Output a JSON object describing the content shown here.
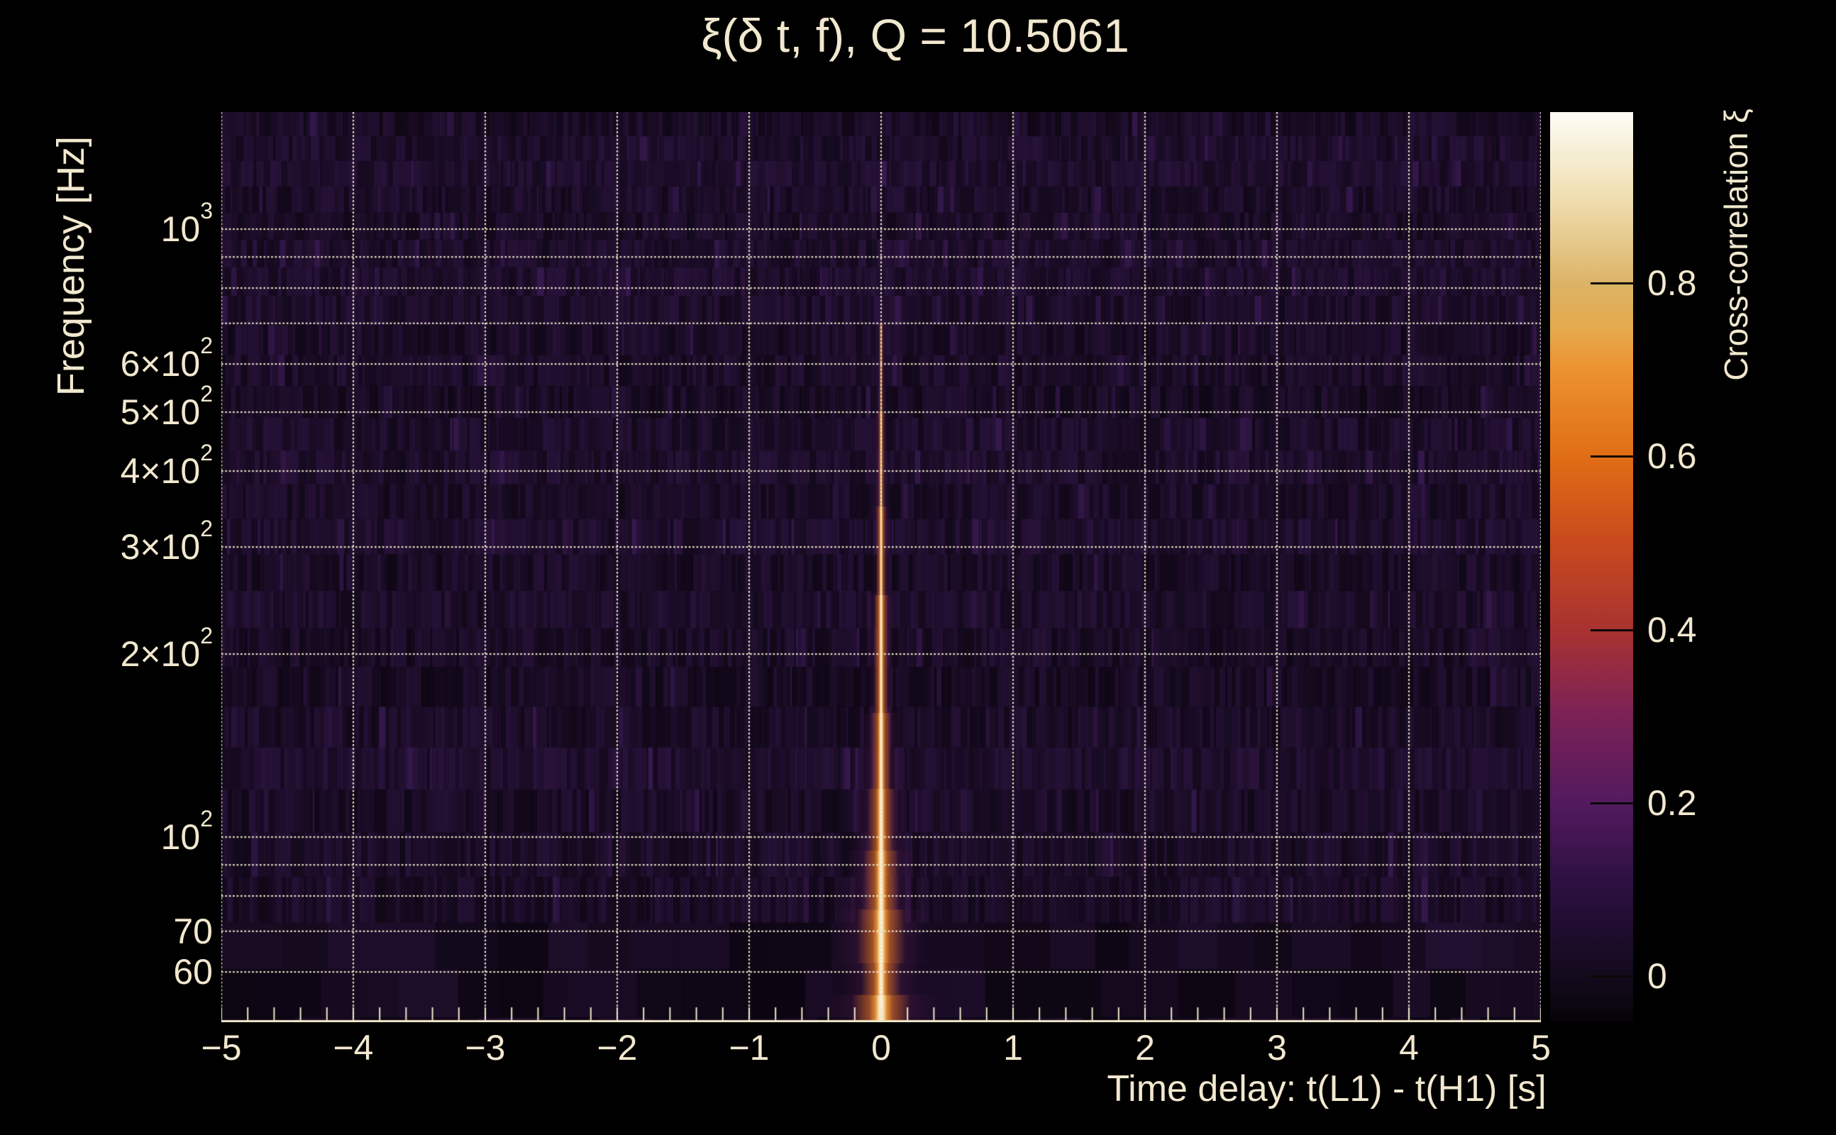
{
  "window": {
    "background": "#000000"
  },
  "title": "ξ(δ t, f), Q = 10.5061",
  "colors": {
    "text": "#f2e8cf",
    "grid": "#efe6ca",
    "axis_line": "#efe6ca",
    "heatmap_base": "#190e23",
    "colorbar_tick": "#0b0805"
  },
  "axes": {
    "x": {
      "label": "Time delay: t(L1) - t(H1) [s]",
      "range": [
        -5,
        5
      ],
      "minor_step": 0.2,
      "major_ticks": [
        {
          "v": -5,
          "label": "−5"
        },
        {
          "v": -4,
          "label": "−4"
        },
        {
          "v": -3,
          "label": "−3"
        },
        {
          "v": -2,
          "label": "−2"
        },
        {
          "v": -1,
          "label": "−1"
        },
        {
          "v": 0,
          "label": "0"
        },
        {
          "v": 1,
          "label": "1"
        },
        {
          "v": 2,
          "label": "2"
        },
        {
          "v": 3,
          "label": "3"
        },
        {
          "v": 4,
          "label": "4"
        },
        {
          "v": 5,
          "label": "5"
        }
      ]
    },
    "y": {
      "label": "Frequency [Hz]",
      "scale": "log",
      "range_hz": [
        50,
        1558
      ],
      "labeled_ticks": [
        {
          "f": 1000,
          "mant": "10",
          "exp": "3"
        },
        {
          "f": 600,
          "mant": "6×10",
          "exp": "2"
        },
        {
          "f": 500,
          "mant": "5×10",
          "exp": "2"
        },
        {
          "f": 400,
          "mant": "4×10",
          "exp": "2"
        },
        {
          "f": 300,
          "mant": "3×10",
          "exp": "2"
        },
        {
          "f": 200,
          "mant": "2×10",
          "exp": "2"
        },
        {
          "f": 100,
          "mant": "10",
          "exp": "2"
        },
        {
          "f": 70,
          "mant": "70",
          "exp": ""
        },
        {
          "f": 60,
          "mant": "60",
          "exp": ""
        }
      ],
      "grid_hz": [
        60,
        70,
        80,
        90,
        100,
        200,
        300,
        400,
        500,
        600,
        700,
        800,
        900,
        1000
      ]
    },
    "z": {
      "label": "Cross-correlation ξ",
      "range": [
        -0.053,
        1.0
      ],
      "ticks": [
        {
          "v": 0.0,
          "label": "0"
        },
        {
          "v": 0.2,
          "label": "0.2"
        },
        {
          "v": 0.4,
          "label": "0.4"
        },
        {
          "v": 0.6,
          "label": "0.6"
        },
        {
          "v": 0.8,
          "label": "0.8"
        }
      ]
    }
  },
  "chart_data": {
    "type": "heatmap",
    "title": "ξ(δ t, f), Q = 10.5061",
    "q_value": 10.5061,
    "xlabel": "Time delay: t(L1) - t(H1) [s]",
    "ylabel": "Frequency [Hz]",
    "zlabel": "Cross-correlation ξ",
    "x_range_s": [
      -5,
      5
    ],
    "y_range_hz": [
      50,
      1558
    ],
    "y_scale": "log",
    "z_range": [
      -0.053,
      1.0
    ],
    "grid": "on",
    "background_xi_level": 0.0,
    "ridge": {
      "delta_t_s": 0.0,
      "xi_peak": 1.0,
      "f_extent_hz": [
        50,
        700
      ],
      "widest_below_hz": 70,
      "profile": [
        {
          "f1": 700,
          "f2": 500,
          "core": 0.8,
          "inner": 1.6,
          "orange": 3.5,
          "wing": 7,
          "a": 0.55
        },
        {
          "f1": 500,
          "f2": 350,
          "core": 1.2,
          "inner": 2.2,
          "orange": 5,
          "wing": 10,
          "a": 0.75
        },
        {
          "f1": 350,
          "f2": 250,
          "core": 1.6,
          "inner": 3,
          "orange": 7,
          "wing": 14,
          "a": 0.92
        },
        {
          "f1": 250,
          "f2": 160,
          "core": 2.2,
          "inner": 4,
          "orange": 10,
          "wing": 20,
          "a": 1
        },
        {
          "f1": 160,
          "f2": 120,
          "core": 3,
          "inner": 5.5,
          "orange": 14,
          "wing": 28,
          "a": 1
        },
        {
          "f1": 120,
          "f2": 95,
          "core": 4,
          "inner": 7,
          "orange": 19,
          "wing": 38,
          "a": 1
        },
        {
          "f1": 95,
          "f2": 76,
          "core": 5,
          "inner": 9,
          "orange": 25,
          "wing": 50,
          "a": 1
        },
        {
          "f1": 76,
          "f2": 62,
          "core": 6,
          "inner": 12,
          "orange": 34,
          "wing": 66,
          "a": 1
        },
        {
          "f1": 62,
          "f2": 55,
          "core": 5,
          "inner": 10,
          "orange": 28,
          "wing": 55,
          "a": 1
        },
        {
          "f1": 55,
          "f2": 50,
          "core": 8,
          "inner": 16,
          "orange": 42,
          "wing": 80,
          "a": 1
        }
      ]
    },
    "palette_stops": [
      {
        "t": 0.0,
        "color": "#060308"
      },
      {
        "t": 0.05,
        "color": "#130a1c"
      },
      {
        "t": 0.15,
        "color": "#2b1040"
      },
      {
        "t": 0.24,
        "color": "#531a5e"
      },
      {
        "t": 0.34,
        "color": "#7c2256"
      },
      {
        "t": 0.43,
        "color": "#a83230"
      },
      {
        "t": 0.53,
        "color": "#c94b1d"
      },
      {
        "t": 0.62,
        "color": "#e06d15"
      },
      {
        "t": 0.72,
        "color": "#ec9430"
      },
      {
        "t": 0.76,
        "color": "#e5a94b"
      },
      {
        "t": 0.81,
        "color": "#dcb365"
      },
      {
        "t": 0.91,
        "color": "#f0e0b4"
      },
      {
        "t": 1.0,
        "color": "#fdfcf5"
      }
    ]
  }
}
